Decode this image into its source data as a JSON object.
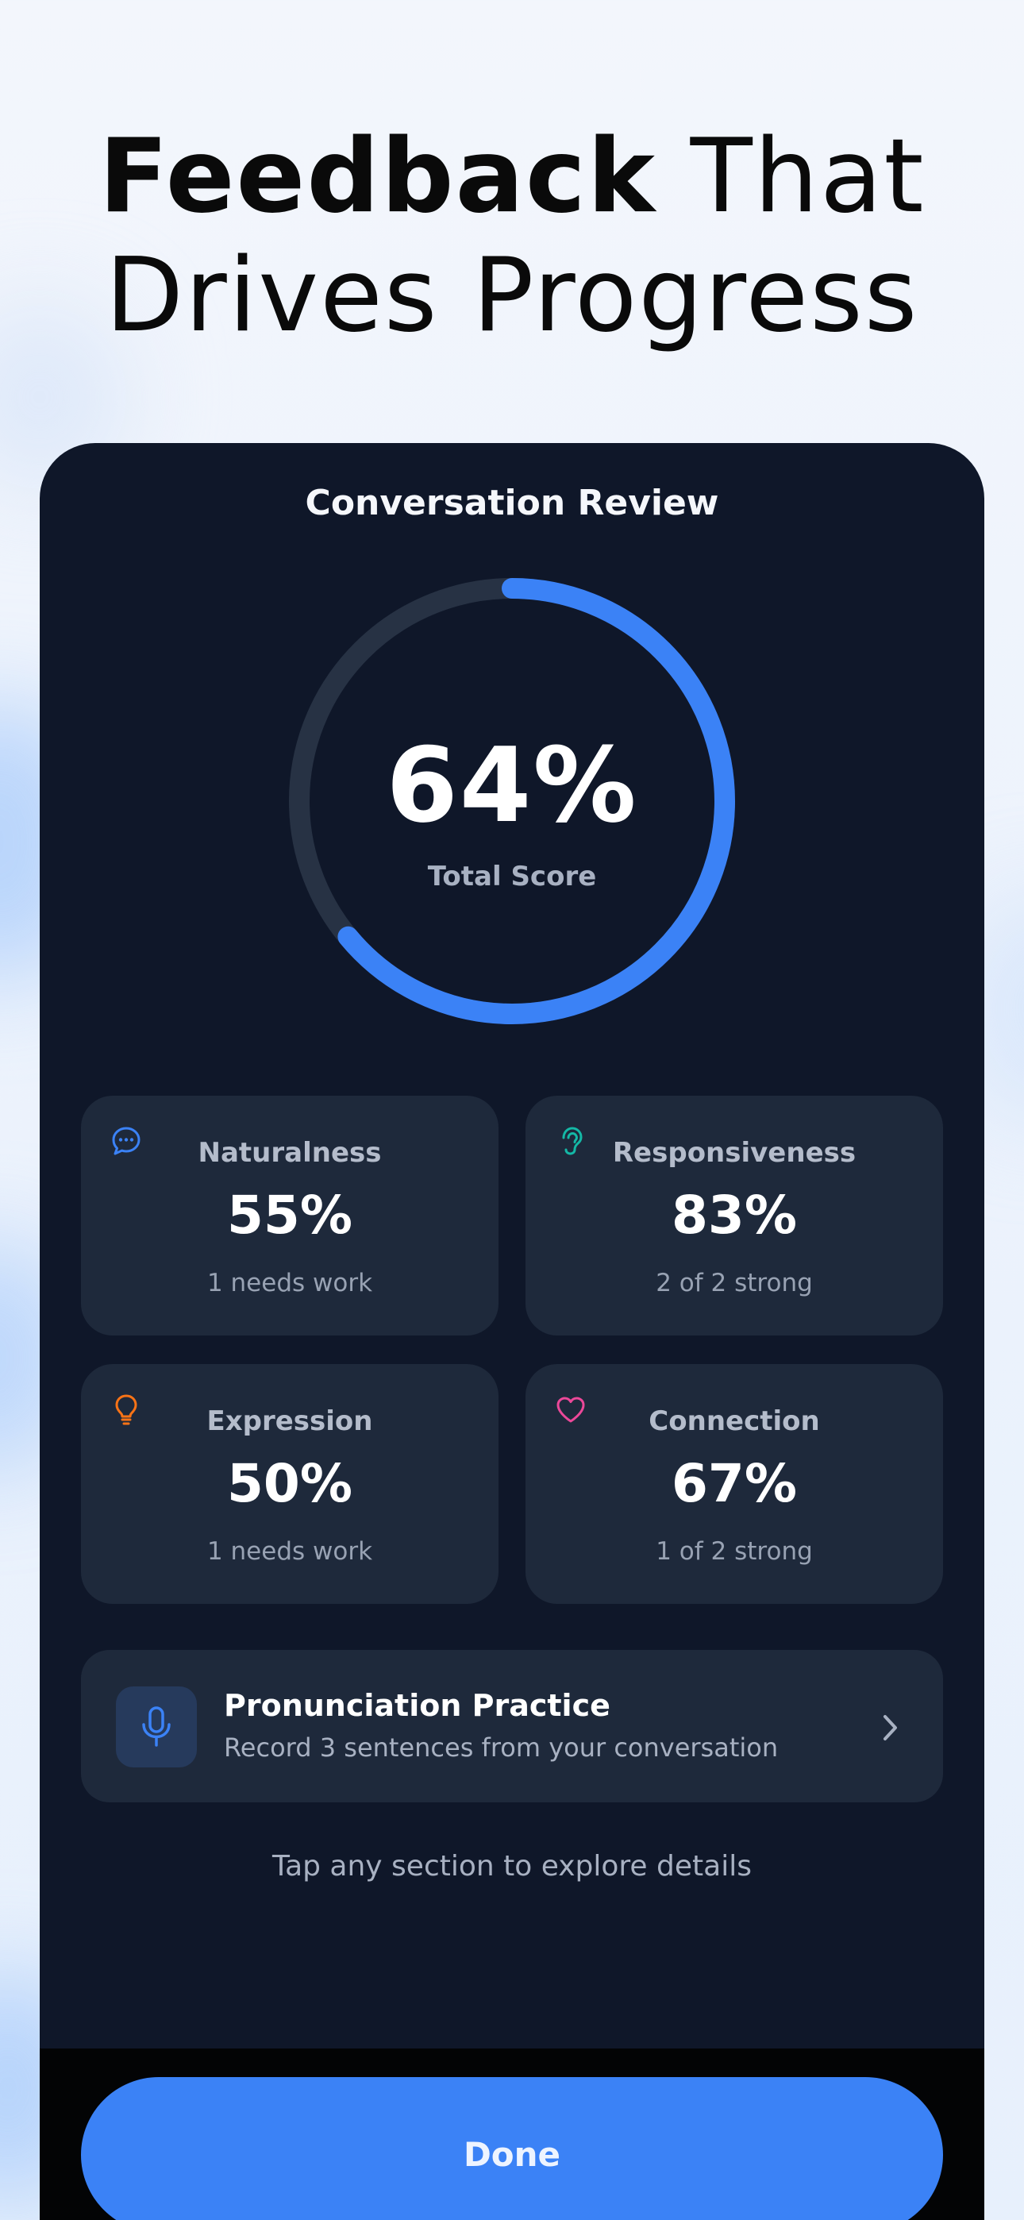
{
  "headline": {
    "bold": "Feedback",
    "rest_line1": "That",
    "line2": "Drives Progress"
  },
  "review": {
    "title": "Conversation Review",
    "total_score": "64%",
    "total_score_fraction": 0.64,
    "total_label": "Total Score",
    "accent_color": "#3b82f6"
  },
  "metrics": [
    {
      "label": "Naturalness",
      "value": "55%",
      "sub": "1 needs work",
      "icon": "chat-bubble-icon",
      "color": "#3b82f6"
    },
    {
      "label": "Responsiveness",
      "value": "83%",
      "sub": "2 of 2 strong",
      "icon": "ear-icon",
      "color": "#14b8a6"
    },
    {
      "label": "Expression",
      "value": "50%",
      "sub": "1 needs work",
      "icon": "lightbulb-icon",
      "color": "#f97316"
    },
    {
      "label": "Connection",
      "value": "67%",
      "sub": "1 of 2 strong",
      "icon": "heart-icon",
      "color": "#ec4899"
    }
  ],
  "practice": {
    "title": "Pronunciation Practice",
    "subtitle": "Record 3 sentences from your conversation",
    "icon": "microphone-icon"
  },
  "hint": "Tap any section to explore details",
  "done_label": "Done"
}
